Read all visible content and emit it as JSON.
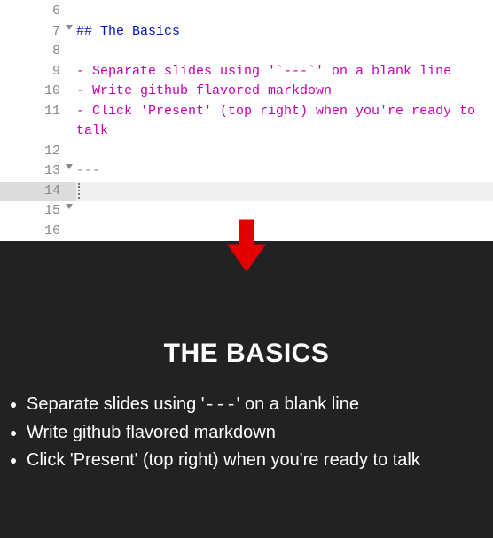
{
  "editor": {
    "lines": [
      {
        "num": "6",
        "fold": false,
        "cls": "",
        "text": ""
      },
      {
        "num": "7",
        "fold": true,
        "cls": "header",
        "text": "## The Basics"
      },
      {
        "num": "8",
        "fold": false,
        "cls": "",
        "text": ""
      },
      {
        "num": "9",
        "fold": false,
        "cls": "list",
        "text": "- Separate slides using '`---`' on a blank line"
      },
      {
        "num": "10",
        "fold": false,
        "cls": "list",
        "text": "- Write github flavored markdown"
      },
      {
        "num": "11",
        "fold": false,
        "cls": "list",
        "text": "- Click 'Present' (top right) when you're ready to talk"
      },
      {
        "num": "12",
        "fold": false,
        "cls": "",
        "text": ""
      },
      {
        "num": "13",
        "fold": true,
        "cls": "hr",
        "text": "---"
      },
      {
        "num": "14",
        "fold": false,
        "cls": "",
        "text": "",
        "active": true
      },
      {
        "num": "15",
        "fold": true,
        "cls": "",
        "text": ""
      },
      {
        "num": "16",
        "fold": false,
        "cls": "",
        "text": ""
      }
    ]
  },
  "preview": {
    "heading": "THE BASICS",
    "bullets": [
      "Separate slides using '---' on a blank line",
      "Write github flavored markdown",
      "Click 'Present' (top right) when you're ready to talk"
    ]
  },
  "colors": {
    "arrow": "#e30000",
    "preview_bg": "#222225"
  }
}
